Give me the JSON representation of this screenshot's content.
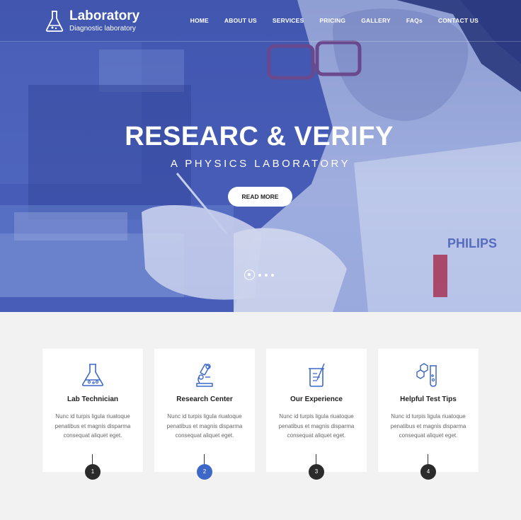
{
  "brand": {
    "title": "Laboratory",
    "subtitle": "Diagnostic laboratory"
  },
  "nav": [
    "HOME",
    "ABOUT US",
    "SERVICES",
    "PRICING",
    "GALLERY",
    "FAQs",
    "CONTACT US"
  ],
  "hero": {
    "title": "RESEARC & VERIFY",
    "subtitle": "A PHYSICS LABORATORY",
    "button": "READ MORE",
    "slide_count": 4,
    "active_slide": 1
  },
  "cards": [
    {
      "icon": "flask-icon",
      "title": "Lab Technician",
      "text": "Nunc id turpis ligula riuatoque penatibus et magnis disparma consequat aliquet eget.",
      "number": "1"
    },
    {
      "icon": "microscope-icon",
      "title": "Research Center",
      "text": "Nunc id turpis ligula riuatoque penatibus et magnis disparma consequat aliquet eget.",
      "number": "2"
    },
    {
      "icon": "beaker-icon",
      "title": "Our Experience",
      "text": "Nunc id turpis ligula riuatoque penatibus et magnis disparma consequat aliquet eget.",
      "number": "3"
    },
    {
      "icon": "molecule-tube-icon",
      "title": "Helpful Test Tips",
      "text": "Nunc id turpis ligula riuatoque penatibus et magnis disparma consequat aliquet eget.",
      "number": "4"
    }
  ],
  "colors": {
    "accent": "#3d68c8",
    "hero_overlay": "#4a62c0",
    "card_bg": "#ffffff",
    "page_bg": "#f2f2f2",
    "dark_circle": "#2b2b2b"
  }
}
